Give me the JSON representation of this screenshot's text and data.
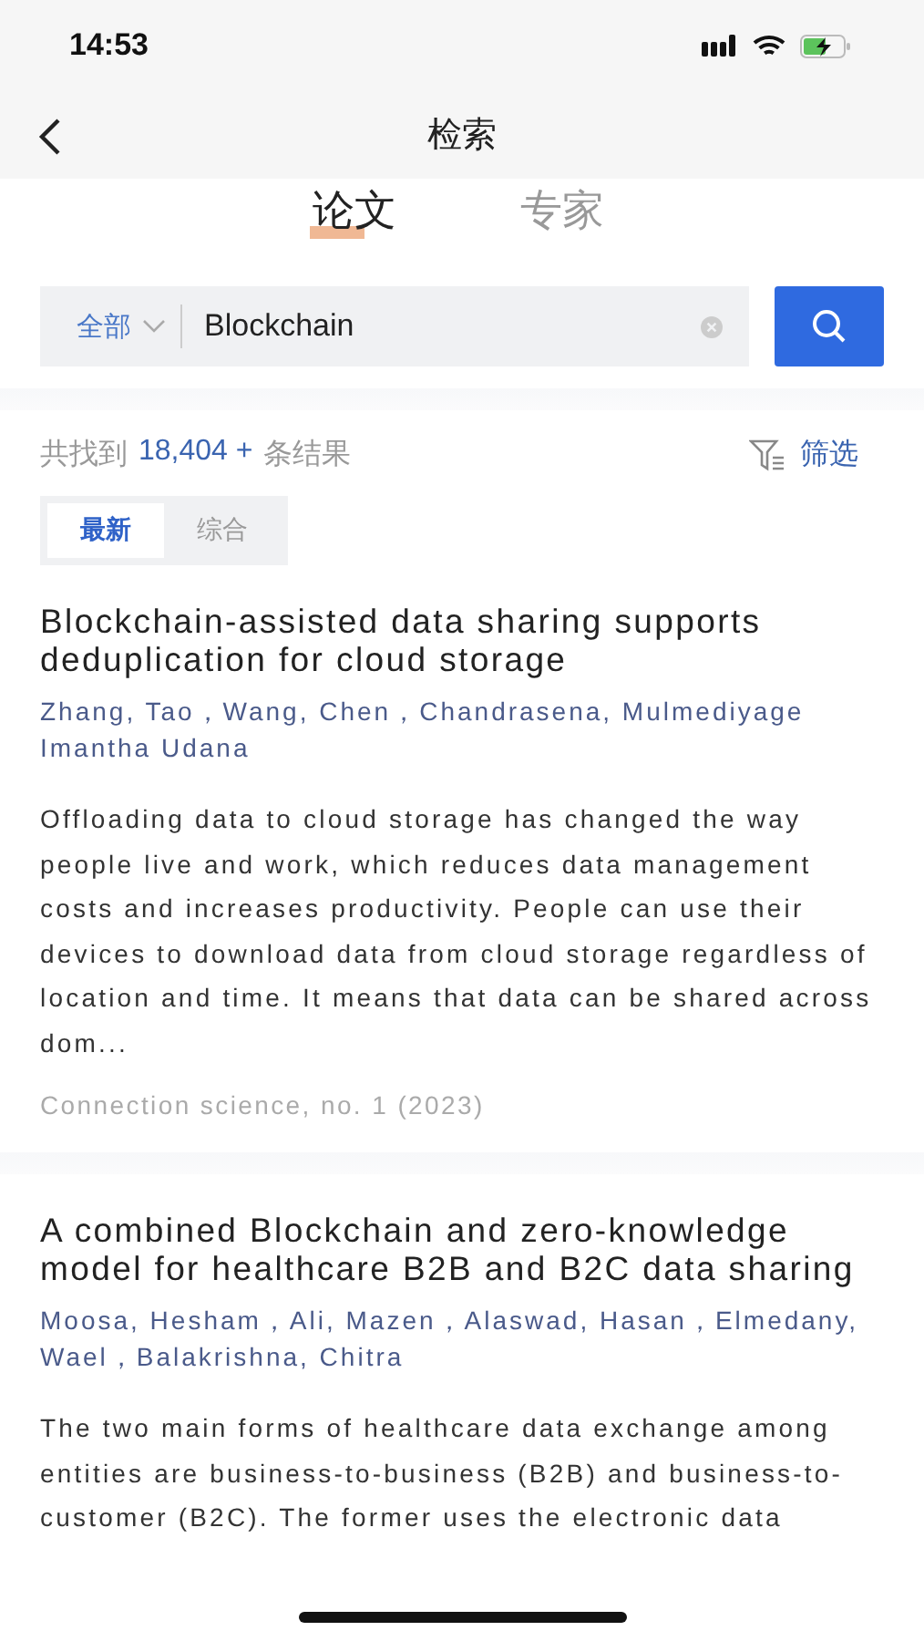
{
  "status_bar": {
    "time": "14:53"
  },
  "nav": {
    "title": "检索"
  },
  "tabs": [
    {
      "label": "论文",
      "selected": true
    },
    {
      "label": "专家",
      "selected": false
    }
  ],
  "search": {
    "scope": "全部",
    "value": "Blockchain"
  },
  "results": {
    "prefix": "共找到",
    "count": "18,404 +",
    "suffix": "条结果",
    "filter": "筛选"
  },
  "sort_tabs": [
    {
      "label": "最新",
      "selected": true
    },
    {
      "label": "综合",
      "selected": false
    }
  ],
  "papers": [
    {
      "title": "Blockchain-assisted data sharing supports deduplication for cloud storage",
      "authors": "Zhang, Tao，Wang, Chen，Chandrasena, Mulmediyage Imantha Udana",
      "abstract": "Offloading data to cloud storage has changed the way people live and work, which reduces data management costs and increases productivity. People can use their devices to download data from cloud storage regardless of location and time. It means that data can be shared across dom...",
      "source": "Connection science, no. 1 (2023)"
    },
    {
      "title": "A combined Blockchain and zero-knowledge model for healthcare B2B and B2C data sharing",
      "authors": "Moosa, Hesham，Ali, Mazen，Alaswad, Hasan，Elmedany, Wael，Balakrishna, Chitra",
      "abstract": "The two main forms of healthcare data exchange among entities are business-to-business (B2B) and business-to-customer (B2C). The former uses the electronic data"
    }
  ]
}
